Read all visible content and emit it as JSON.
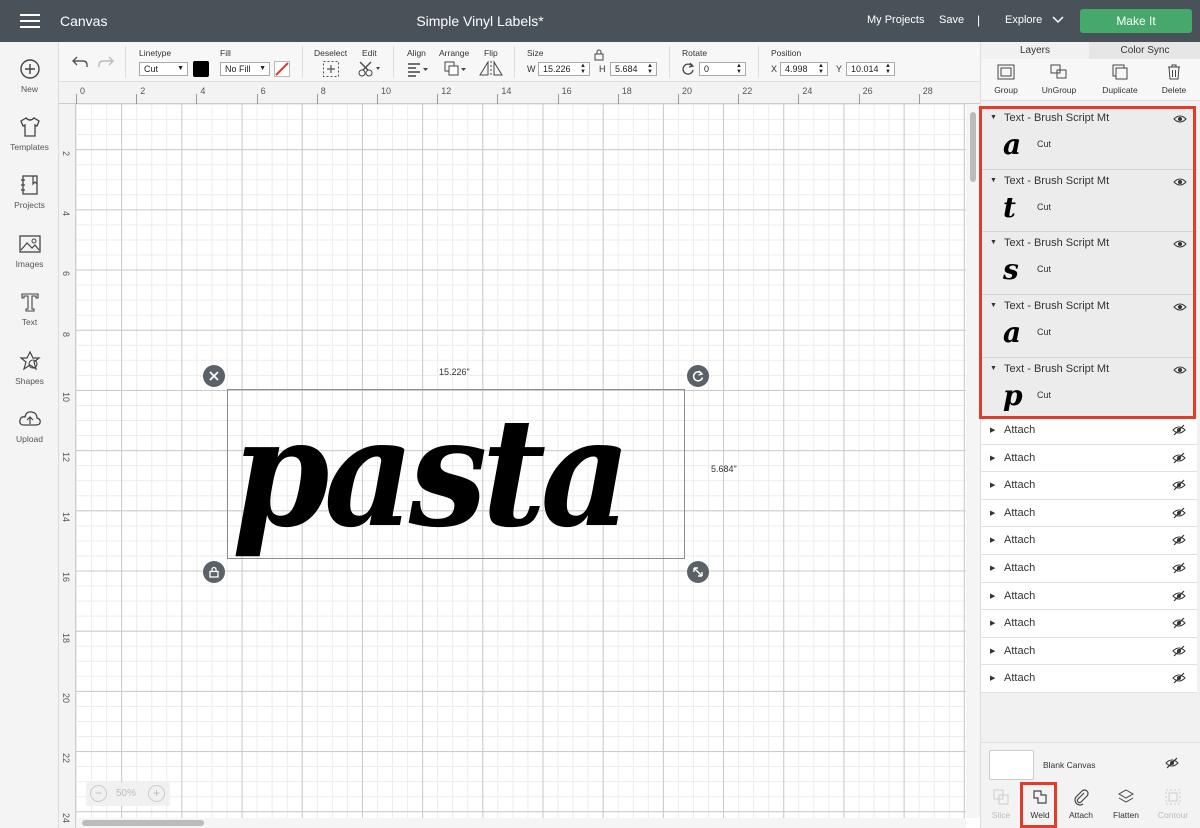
{
  "header": {
    "app_name": "Canvas",
    "doc_title": "Simple Vinyl Labels*",
    "my_projects": "My Projects",
    "save": "Save",
    "separator": "|",
    "explore": "Explore",
    "make_it": "Make It"
  },
  "sidebar": {
    "items": [
      {
        "label": "New",
        "icon": "plus-circle-icon"
      },
      {
        "label": "Templates",
        "icon": "shirt-icon"
      },
      {
        "label": "Projects",
        "icon": "notebook-icon"
      },
      {
        "label": "Images",
        "icon": "image-icon"
      },
      {
        "label": "Text",
        "icon": "text-t-icon"
      },
      {
        "label": "Shapes",
        "icon": "shapes-icon"
      },
      {
        "label": "Upload",
        "icon": "cloud-upload-icon"
      }
    ]
  },
  "toolbar": {
    "linetype_label": "Linetype",
    "linetype_value": "Cut",
    "fill_label": "Fill",
    "fill_value": "No Fill",
    "deselect_label": "Deselect",
    "edit_label": "Edit",
    "align_label": "Align",
    "arrange_label": "Arrange",
    "flip_label": "Flip",
    "size_label": "Size",
    "w_label": "W",
    "w_value": "15.226",
    "h_label": "H",
    "h_value": "5.684",
    "rotate_label": "Rotate",
    "rotate_value": "0",
    "position_label": "Position",
    "x_label": "X",
    "x_value": "4.998",
    "y_label": "Y",
    "y_value": "10.014",
    "color_swatch": "#000000"
  },
  "ruler": {
    "top": [
      "0",
      "2",
      "4",
      "6",
      "8",
      "10",
      "12",
      "14",
      "16",
      "18",
      "20",
      "22",
      "24",
      "26",
      "28"
    ],
    "left": [
      "2",
      "4",
      "6",
      "8",
      "10",
      "12",
      "14",
      "16",
      "18",
      "20",
      "22",
      "24"
    ]
  },
  "canvas": {
    "text": "pasta",
    "width_label": "15.226\"",
    "height_label": "5.684\"",
    "zoom": "50%",
    "zoom_minus": "−",
    "zoom_plus": "+"
  },
  "panel": {
    "tabs": [
      "Layers",
      "Color Sync"
    ],
    "actions": [
      "Group",
      "UnGroup",
      "Duplicate",
      "Delete"
    ],
    "layers": [
      {
        "name": "Text - Brush Script Mt",
        "glyph": "a",
        "op": "Cut"
      },
      {
        "name": "Text - Brush Script Mt",
        "glyph": "t",
        "op": "Cut"
      },
      {
        "name": "Text - Brush Script Mt",
        "glyph": "s",
        "op": "Cut"
      },
      {
        "name": "Text - Brush Script Mt",
        "glyph": "a",
        "op": "Cut"
      },
      {
        "name": "Text - Brush Script Mt",
        "glyph": "p",
        "op": "Cut"
      }
    ],
    "attach_groups": [
      "Attach",
      "Attach",
      "Attach",
      "Attach",
      "Attach",
      "Attach",
      "Attach",
      "Attach",
      "Attach",
      "Attach"
    ],
    "blank_canvas": "Blank Canvas",
    "bottom_actions": [
      "Slice",
      "Weld",
      "Attach",
      "Flatten",
      "Contour"
    ]
  },
  "colors": {
    "header_bg": "#4a5259",
    "make_it_green": "#46a86a",
    "highlight_red": "#e03c2c"
  }
}
